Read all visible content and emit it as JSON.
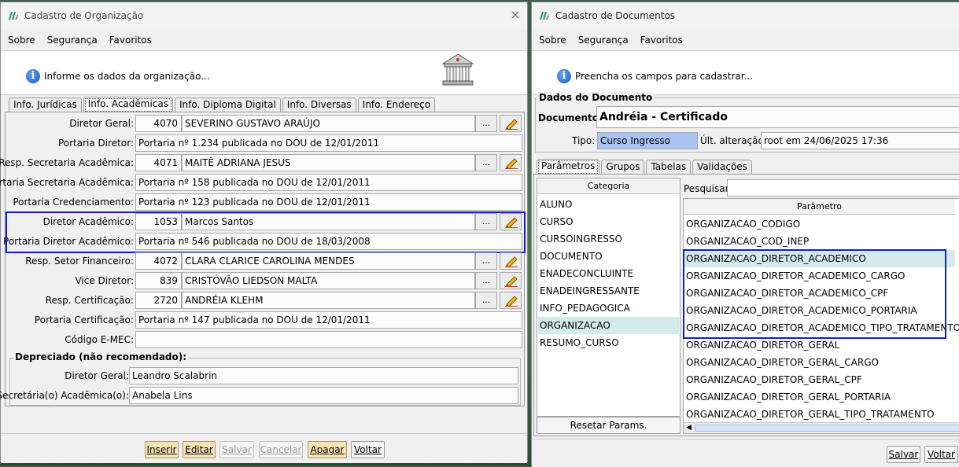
{
  "org_window": {
    "title": "Cadastro de Organização",
    "menu": [
      "Sobre",
      "Segurança",
      "Favoritos"
    ],
    "header_text": "Informe os dados da organização...",
    "tabs": [
      "Info. Jurídicas",
      "Info. Acadêmicas",
      "Info. Diploma Digital",
      "Info. Diversas",
      "Info. Endereço"
    ],
    "active_tab": "Info. Acadêmicas",
    "fields": {
      "diretor_geral": {
        "label": "Diretor Geral:",
        "code": "4070",
        "name": "SEVERINO GUSTAVO ARAÚJO"
      },
      "portaria_diretor": {
        "label": "Portaria Diretor:",
        "value": "Portaria nº 1.234 publicada no DOU de 12/01/2011"
      },
      "resp_secretaria": {
        "label": "Resp. Secretaria Acadêmica:",
        "code": "4071",
        "name": "MAITÊ ADRIANA JESUS"
      },
      "portaria_secretaria": {
        "label": "Portaria Secretaria Acadêmica:",
        "value": "Portaria nº 158 publicada no DOU de 12/01/2011"
      },
      "portaria_credenciamento": {
        "label": "Portaria Credenciamento:",
        "value": "Portaria nº 123 publicada no DOU de 12/01/2011"
      },
      "diretor_academico": {
        "label": "Diretor Acadêmico:",
        "code": "1053",
        "name": "Marcos Santos"
      },
      "portaria_diretor_academico": {
        "label": "Portaria Diretor Acadêmico:",
        "value": "Portaria nº 546 publicada no DOU de 18/03/2008"
      },
      "resp_financeiro": {
        "label": "Resp. Setor Financeiro:",
        "code": "4072",
        "name": "CLARA CLARICE CAROLINA MENDES"
      },
      "vice_diretor": {
        "label": "Vice Diretor:",
        "code": "839",
        "name": "CRISTÓVÃO LIEDSON MALTA"
      },
      "resp_certificacao": {
        "label": "Resp. Certificação:",
        "code": "2720",
        "name": "ANDRÉIA KLEHM"
      },
      "portaria_certificacao": {
        "label": "Portaria Certificação:",
        "value": "Portaria nº 147 publicada no DOU de 12/01/2011"
      },
      "codigo_emec": {
        "label": "Código E-MEC:",
        "value": ""
      }
    },
    "lookup_label": "...",
    "depreciado": {
      "title": "Depreciado (não recomendado):",
      "diretor_geral_label": "Diretor Geral:",
      "diretor_geral": "Leandro Scalabrin",
      "secretaria_label": "Secretária(o) Acadêmica(o):",
      "secretaria": "Anabela Lins"
    },
    "buttons": {
      "inserir": "Inserir",
      "editar": "Editar",
      "salvar": "Salvar",
      "cancelar": "Cancelar",
      "apagar": "Apagar",
      "voltar": "Voltar"
    }
  },
  "doc_window": {
    "title": "Cadastro de Documentos",
    "menu": [
      "Sobre",
      "Segurança",
      "Favoritos"
    ],
    "header_text": "Preencha os campos para cadastrar...",
    "dados_title": "Dados do Documento",
    "documento_label": "Documento:",
    "documento_value": "Andréia - Certificado",
    "tipo_label": "Tipo:",
    "tipo_value": "Curso Ingresso",
    "ult_label": "Últ. alteração:",
    "ult_value": "root em 24/06/2025 17:36",
    "tabs": [
      "Parâmetros",
      "Grupos",
      "Tabelas",
      "Validações"
    ],
    "categoria_header": "Categoria",
    "categorias": [
      "ALUNO",
      "CURSO",
      "CURSOINGRESSO",
      "DOCUMENTO",
      "ENADECONCLUINTE",
      "ENADEINGRESSANTE",
      "INFO_PEDAGOGICA",
      "ORGANIZACAO",
      "RESUMO_CURSO"
    ],
    "selected_categoria": "ORGANIZACAO",
    "resetar_label": "Resetar Params.",
    "pesquisar_label": "Pesquisar:",
    "pesquisar_value": "",
    "parametro_header": "Parâmetro",
    "parametros": [
      "ORGANIZACAO_CODIGO",
      "ORGANIZACAO_COD_INEP",
      "ORGANIZACAO_DIRETOR_ACADEMICO",
      "ORGANIZACAO_DIRETOR_ACADEMICO_CARGO",
      "ORGANIZACAO_DIRETOR_ACADEMICO_CPF",
      "ORGANIZACAO_DIRETOR_ACADEMICO_PORTARIA",
      "ORGANIZACAO_DIRETOR_ACADEMICO_TIPO_TRATAMENTO",
      "ORGANIZACAO_DIRETOR_GERAL",
      "ORGANIZACAO_DIRETOR_GERAL_CARGO",
      "ORGANIZACAO_DIRETOR_GERAL_CPF",
      "ORGANIZACAO_DIRETOR_GERAL_PORTARIA",
      "ORGANIZACAO_DIRETOR_GERAL_TIPO_TRATAMENTO"
    ],
    "buttons": {
      "salvar": "Salvar",
      "voltar": "Voltar"
    }
  },
  "colors": {
    "highlight_border": "#1020d0",
    "selected_row": "#d4ebeb",
    "tipo_bg": "#a9c4f2",
    "hot_button": "#f4e5b8"
  }
}
